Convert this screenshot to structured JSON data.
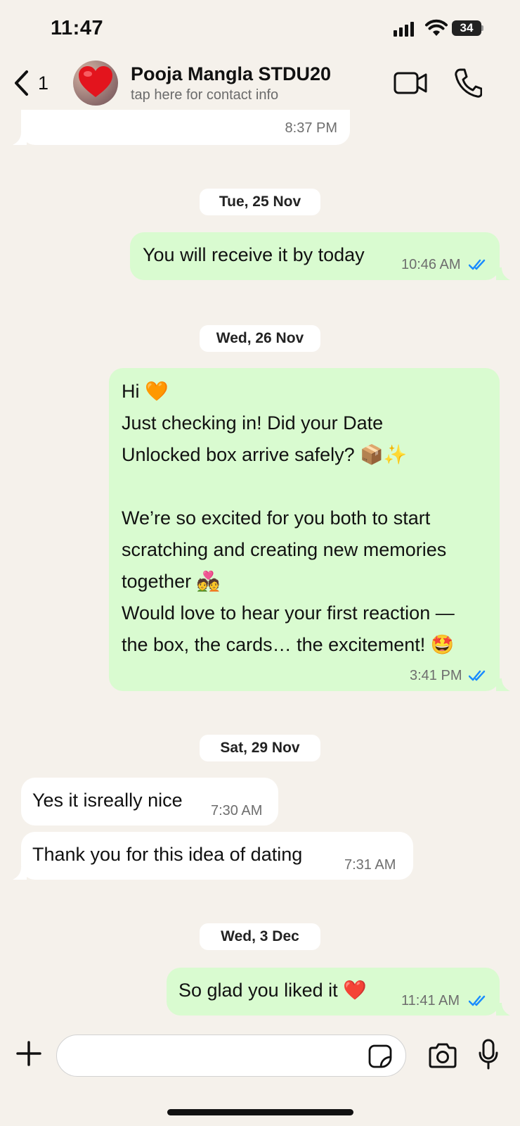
{
  "status_bar": {
    "time": "11:47",
    "battery": "34"
  },
  "header": {
    "back_count": "1",
    "contact_name": "Pooja Mangla STDU20",
    "contact_subtitle": "tap here for contact info"
  },
  "messages": [
    {
      "type": "in",
      "text": "",
      "time": "8:37 PM"
    },
    {
      "type": "date",
      "text": "Tue, 25 Nov"
    },
    {
      "type": "out",
      "text": "You will receive it by today",
      "time": "10:46 AM",
      "status": "read"
    },
    {
      "type": "date",
      "text": "Wed, 26 Nov"
    },
    {
      "type": "out",
      "lines": [
        "Hi 🧡",
        "Just checking in! Did your Date",
        "Unlocked box arrive safely? 📦✨",
        "",
        "We’re so excited for you both to start",
        "scratching and creating new memories",
        "together 💑",
        "Would love to hear your first reaction —",
        "the box, the cards… the excitement! 🤩"
      ],
      "time": "3:41 PM",
      "status": "read"
    },
    {
      "type": "date",
      "text": "Sat, 29 Nov"
    },
    {
      "type": "in",
      "text": "Yes it isreally nice",
      "time": "7:30 AM"
    },
    {
      "type": "in",
      "text": "Thank you for this idea of dating",
      "time": "7:31 AM"
    },
    {
      "type": "date",
      "text": "Wed, 3 Dec"
    },
    {
      "type": "out",
      "text": "So glad you liked it ❤️",
      "time": "11:41 AM",
      "status": "read"
    }
  ],
  "composer": {
    "input_value": ""
  },
  "colors": {
    "background": "#f5f1eb",
    "outgoing": "#d9fbd0",
    "incoming": "#ffffff",
    "read_ticks": "#1a8cff"
  },
  "icons": [
    "chevron-left-icon",
    "video-camera-icon",
    "phone-icon",
    "plus-icon",
    "sticker-icon",
    "camera-icon",
    "microphone-icon",
    "double-check-icon"
  ]
}
